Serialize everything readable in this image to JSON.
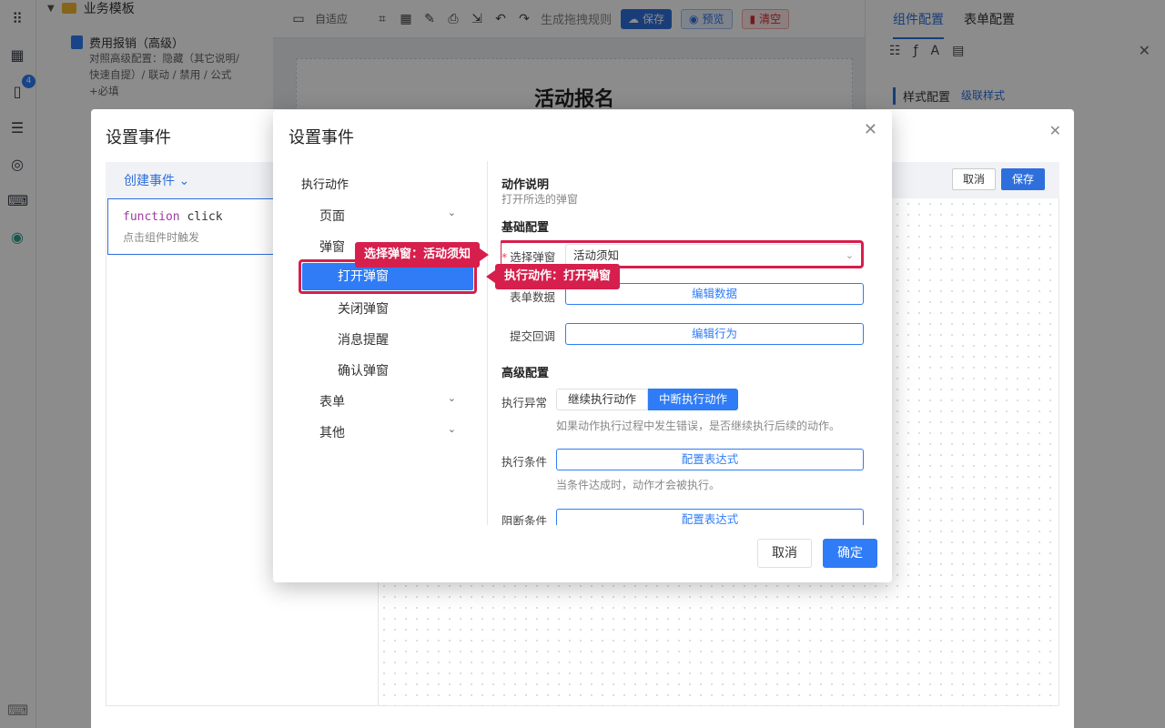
{
  "sidebar": {
    "badge_count": "4"
  },
  "tree": {
    "folder_label": "业务模板",
    "item_title": "费用报销（高级）",
    "item_desc": "对照高级配置：隐藏（其它说明/快速自提）/ 联动 / 禁用 / 公式+必填"
  },
  "toolbar": {
    "adapt_label": "自适应",
    "gen_rule_label": "生成拖拽规则",
    "save_label": "保存",
    "preview_label": "预览",
    "clear_label": "清空"
  },
  "canvas": {
    "form_title": "活动报名"
  },
  "right_panel": {
    "tab_component": "组件配置",
    "tab_form": "表单配置",
    "style_config": "样式配置",
    "cascade_style": "级联样式"
  },
  "event_modal": {
    "title": "设置事件",
    "create_event": "创建事件",
    "cancel": "取消",
    "save": "保存",
    "fn_keyword": "function",
    "fn_name": "click",
    "fn_desc": "点击组件时触发"
  },
  "dialog": {
    "title": "设置事件",
    "menu_head": "执行动作",
    "menu": {
      "page": "页面",
      "popup": "弹窗",
      "open_popup": "打开弹窗",
      "close_popup": "关闭弹窗",
      "message": "消息提醒",
      "confirm_popup": "确认弹窗",
      "form": "表单",
      "other": "其他"
    },
    "action_desc_title": "动作说明",
    "action_desc_text": "打开所选的弹窗",
    "basic_config": "基础配置",
    "select_popup_label": "选择弹窗",
    "select_popup_value": "活动须知",
    "form_data_label": "表单数据",
    "edit_data": "编辑数据",
    "submit_callback_label": "提交回调",
    "edit_behavior": "编辑行为",
    "advanced_config": "高级配置",
    "exec_error_label": "执行异常",
    "continue_exec": "继续执行动作",
    "abort_exec": "中断执行动作",
    "exec_error_hint": "如果动作执行过程中发生错误，是否继续执行后续的动作。",
    "exec_condition_label": "执行条件",
    "config_expression": "配置表达式",
    "exec_condition_hint": "当条件达成时，动作才会被执行。",
    "block_condition_label": "阻断条件",
    "cancel": "取消",
    "ok": "确定"
  },
  "callouts": {
    "select_popup": "选择弹窗：活动须知",
    "exec_action": "执行动作：打开弹窗"
  },
  "colors": {
    "accent": "#2f7cf6",
    "highlight": "#d61f4c"
  }
}
